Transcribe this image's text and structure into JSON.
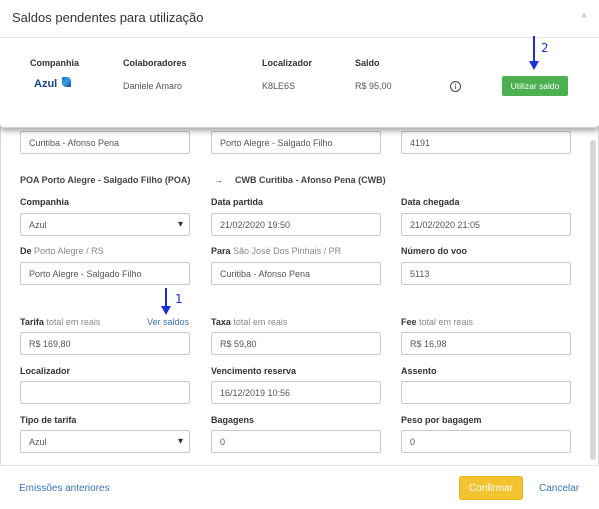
{
  "popup": {
    "title": "Saldos pendentes para utilização",
    "close": "×",
    "headers": {
      "companhia": "Companhia",
      "colaboradores": "Colaboradores",
      "localizador": "Localizador",
      "saldo": "Saldo"
    },
    "row": {
      "companhia_logo": "Azul",
      "colaborador": "Daniele Amaro",
      "localizador": "K8LE6S",
      "saldo": "R$ 95,00",
      "info": "i"
    },
    "utilizar_label": "Utilizar saldo"
  },
  "top_inputs": [
    "Curitiba - Afonso Pena",
    "Porto Alegre - Salgado Filho",
    "4191"
  ],
  "route": {
    "from": "POA Porto Alegre - Salgado Filho (POA)",
    "arrow": "→",
    "to": "CWB Curitiba - Afonso Pena (CWB)"
  },
  "form": {
    "companhia": {
      "label": "Companhia",
      "value": "Azul"
    },
    "data_partida": {
      "label": "Data partida",
      "value": "21/02/2020 19:50"
    },
    "data_chegada": {
      "label": "Data chegada",
      "value": "21/02/2020 21:05"
    },
    "de": {
      "label": "De",
      "hint": "Porto Alegre / RS",
      "value": "Porto Alegre - Salgado Filho"
    },
    "para": {
      "label": "Para",
      "hint": "São José Dos Pinhais / PR",
      "value": "Curitiba - Afonso Pena"
    },
    "numero_voo": {
      "label": "Número do voo",
      "value": "5113"
    },
    "tarifa": {
      "label": "Tarifa",
      "hint": "total em reais",
      "value": "R$ 169,80",
      "link": "Ver saldos"
    },
    "taxa": {
      "label": "Taxa",
      "hint": "total em reais",
      "value": "R$ 59,80"
    },
    "fee": {
      "label": "Fee",
      "hint": "total em reais",
      "value": "R$ 16,98"
    },
    "localizador": {
      "label": "Localizador",
      "value": ""
    },
    "vencimento": {
      "label": "Vencimento reserva",
      "value": "16/12/2019 10:56"
    },
    "assento": {
      "label": "Assento",
      "value": ""
    },
    "tipo_tarifa": {
      "label": "Tipo de tarifa",
      "value": "Azul"
    },
    "bagagens": {
      "label": "Bagagens",
      "value": "0"
    },
    "peso_bagagem": {
      "label": "Peso por bagagem",
      "value": "0"
    }
  },
  "footer": {
    "emissoes": "Emissões anteriores",
    "confirmar": "Confirmar",
    "cancelar": "Cancelar"
  },
  "annotations": {
    "one": "1",
    "two": "2"
  },
  "colors": {
    "accent_link": "#3a73b8",
    "confirm": "#f4c430",
    "utilizar": "#4caf50",
    "annotation": "#1a33d6"
  }
}
